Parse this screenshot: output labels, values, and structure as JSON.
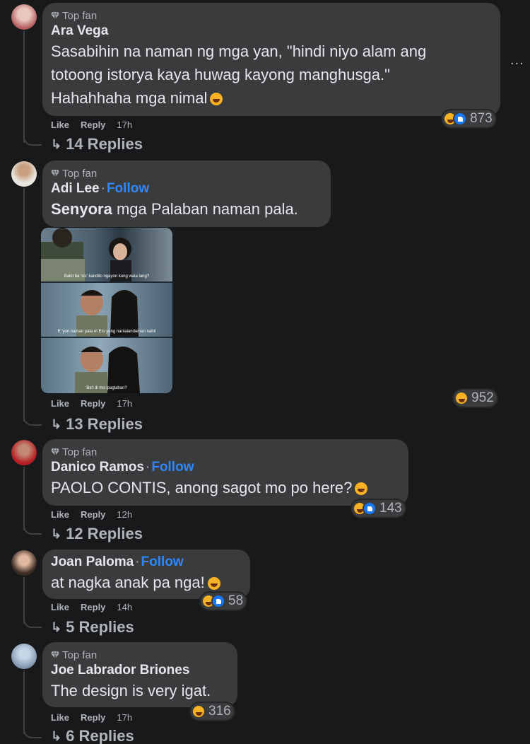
{
  "ui": {
    "more_options": "...",
    "reply_arrow": "↳"
  },
  "comments": [
    {
      "badge": "Top fan",
      "name": "Ara Vega",
      "follow": "",
      "text_lines": [
        "Sasabihin na naman ng mga yan, \"hindi niyo alam ang",
        "totoong istorya kaya huwag kayong manghusga.\"",
        "Hahahhaha mga nimal"
      ],
      "reaction_count": "873",
      "like": "Like",
      "reply": "Reply",
      "time": "17h",
      "replies": "14 Replies"
    },
    {
      "badge": "Top fan",
      "name": "Adi Lee",
      "follow": "Follow",
      "text_bold": "Senyora",
      "text_rest": " mga Palaban naman pala.",
      "meme_captions": [
        "Bakit ba 'sis' kandito ngayon kung wala lang?",
        "E 'yon naman pala e! Eto yung nanlalandaman nahil",
        "Ba't di mo ipaglaban?"
      ],
      "reaction_count": "952",
      "like": "Like",
      "reply": "Reply",
      "time": "17h",
      "replies": "13 Replies"
    },
    {
      "badge": "Top fan",
      "name": "Danico Ramos",
      "follow": "Follow",
      "text": "PAOLO CONTIS, anong sagot mo po here?",
      "reaction_count": "143",
      "like": "Like",
      "reply": "Reply",
      "time": "12h",
      "replies": "12 Replies"
    },
    {
      "badge": "",
      "name": "Joan Paloma",
      "follow": "Follow",
      "text": "at nagka anak pa nga!",
      "reaction_count": "58",
      "like": "Like",
      "reply": "Reply",
      "time": "14h",
      "replies": "5 Replies"
    },
    {
      "badge": "Top fan",
      "name": "Joe Labrador Briones",
      "follow": "",
      "text": "The design is very igat.",
      "reaction_count": "316",
      "like": "Like",
      "reply": "Reply",
      "time": "17h",
      "replies": "6 Replies"
    }
  ],
  "colors": {
    "background": "#18191a",
    "bubble": "#3a3b3c",
    "follow": "#2d88ff",
    "secondary_text": "#b0b3b8",
    "haha": "#f7b125",
    "like": "#1877f2"
  }
}
